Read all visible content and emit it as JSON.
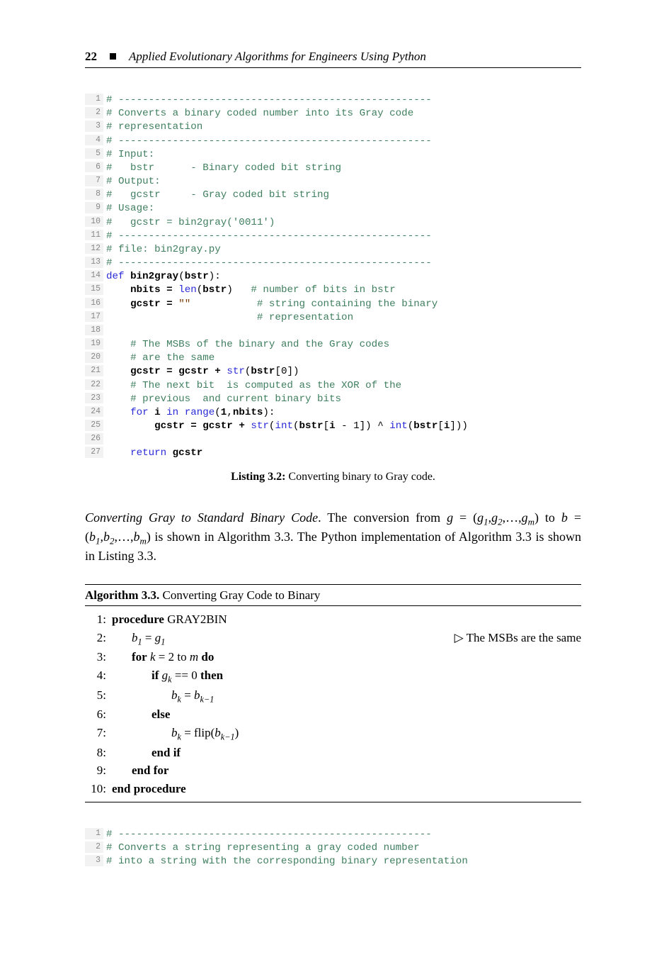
{
  "header": {
    "page_number": "22",
    "book_title": "Applied Evolutionary Algorithms for Engineers Using Python"
  },
  "code1": {
    "lines": [
      {
        "n": "1",
        "seg": [
          {
            "c": "com",
            "t": "# ----------------------------------------------------"
          }
        ]
      },
      {
        "n": "2",
        "seg": [
          {
            "c": "com",
            "t": "# Converts a binary coded number into its Gray code"
          }
        ]
      },
      {
        "n": "3",
        "seg": [
          {
            "c": "com",
            "t": "# representation"
          }
        ]
      },
      {
        "n": "4",
        "seg": [
          {
            "c": "com",
            "t": "# ----------------------------------------------------"
          }
        ]
      },
      {
        "n": "5",
        "seg": [
          {
            "c": "com",
            "t": "# Input:"
          }
        ]
      },
      {
        "n": "6",
        "seg": [
          {
            "c": "com",
            "t": "#   bstr      - Binary coded bit string"
          }
        ]
      },
      {
        "n": "7",
        "seg": [
          {
            "c": "com",
            "t": "# Output:"
          }
        ]
      },
      {
        "n": "8",
        "seg": [
          {
            "c": "com",
            "t": "#   gcstr     - Gray coded bit string"
          }
        ]
      },
      {
        "n": "9",
        "seg": [
          {
            "c": "com",
            "t": "# Usage:"
          }
        ]
      },
      {
        "n": "10",
        "seg": [
          {
            "c": "com",
            "t": "#   gcstr = bin2gray('0011')"
          }
        ]
      },
      {
        "n": "11",
        "seg": [
          {
            "c": "com",
            "t": "# ----------------------------------------------------"
          }
        ]
      },
      {
        "n": "12",
        "seg": [
          {
            "c": "com",
            "t": "# file: bin2gray.py"
          }
        ]
      },
      {
        "n": "13",
        "seg": [
          {
            "c": "com",
            "t": "# ----------------------------------------------------"
          }
        ]
      },
      {
        "n": "14",
        "seg": [
          {
            "c": "bi",
            "t": "def "
          },
          {
            "c": "nm",
            "t": "bin2gray"
          },
          {
            "c": "",
            "t": "("
          },
          {
            "c": "nm",
            "t": "bstr"
          },
          {
            "c": "",
            "t": "):"
          }
        ]
      },
      {
        "n": "15",
        "seg": [
          {
            "c": "",
            "t": "    "
          },
          {
            "c": "nm",
            "t": "nbits"
          },
          {
            "c": "",
            "t": " "
          },
          {
            "c": "nm",
            "t": "="
          },
          {
            "c": "",
            "t": " "
          },
          {
            "c": "bi",
            "t": "len"
          },
          {
            "c": "",
            "t": "("
          },
          {
            "c": "nm",
            "t": "bstr"
          },
          {
            "c": "",
            "t": ")   "
          },
          {
            "c": "com",
            "t": "# number of bits in bstr"
          }
        ]
      },
      {
        "n": "16",
        "seg": [
          {
            "c": "",
            "t": "    "
          },
          {
            "c": "nm",
            "t": "gcstr"
          },
          {
            "c": "",
            "t": " "
          },
          {
            "c": "nm",
            "t": "="
          },
          {
            "c": "",
            "t": " "
          },
          {
            "c": "str",
            "t": "\"\""
          },
          {
            "c": "",
            "t": "           "
          },
          {
            "c": "com",
            "t": "# string containing the binary"
          }
        ]
      },
      {
        "n": "17",
        "seg": [
          {
            "c": "",
            "t": "                         "
          },
          {
            "c": "com",
            "t": "# representation"
          }
        ]
      },
      {
        "n": "18",
        "seg": [
          {
            "c": "",
            "t": ""
          }
        ]
      },
      {
        "n": "19",
        "seg": [
          {
            "c": "",
            "t": "    "
          },
          {
            "c": "com",
            "t": "# The MSBs of the binary and the Gray codes"
          }
        ]
      },
      {
        "n": "20",
        "seg": [
          {
            "c": "",
            "t": "    "
          },
          {
            "c": "com",
            "t": "# are the same"
          }
        ]
      },
      {
        "n": "21",
        "seg": [
          {
            "c": "",
            "t": "    "
          },
          {
            "c": "nm",
            "t": "gcstr"
          },
          {
            "c": "",
            "t": " "
          },
          {
            "c": "nm",
            "t": "="
          },
          {
            "c": "",
            "t": " "
          },
          {
            "c": "nm",
            "t": "gcstr"
          },
          {
            "c": "",
            "t": " "
          },
          {
            "c": "nm",
            "t": "+"
          },
          {
            "c": "",
            "t": " "
          },
          {
            "c": "bi",
            "t": "str"
          },
          {
            "c": "",
            "t": "("
          },
          {
            "c": "nm",
            "t": "bstr"
          },
          {
            "c": "",
            "t": "[0])"
          }
        ]
      },
      {
        "n": "22",
        "seg": [
          {
            "c": "",
            "t": "    "
          },
          {
            "c": "com",
            "t": "# The next bit  is computed as the XOR of the"
          }
        ]
      },
      {
        "n": "23",
        "seg": [
          {
            "c": "",
            "t": "    "
          },
          {
            "c": "com",
            "t": "# previous  and current binary bits"
          }
        ]
      },
      {
        "n": "24",
        "seg": [
          {
            "c": "",
            "t": "    "
          },
          {
            "c": "bi",
            "t": "for"
          },
          {
            "c": "",
            "t": " "
          },
          {
            "c": "nm",
            "t": "i"
          },
          {
            "c": "",
            "t": " "
          },
          {
            "c": "bi",
            "t": "in"
          },
          {
            "c": "",
            "t": " "
          },
          {
            "c": "bi",
            "t": "range"
          },
          {
            "c": "",
            "t": "("
          },
          {
            "c": "nm",
            "t": "1"
          },
          {
            "c": "",
            "t": ","
          },
          {
            "c": "nm",
            "t": "nbits"
          },
          {
            "c": "",
            "t": "):"
          }
        ]
      },
      {
        "n": "25",
        "seg": [
          {
            "c": "",
            "t": "        "
          },
          {
            "c": "nm",
            "t": "gcstr"
          },
          {
            "c": "",
            "t": " "
          },
          {
            "c": "nm",
            "t": "="
          },
          {
            "c": "",
            "t": " "
          },
          {
            "c": "nm",
            "t": "gcstr"
          },
          {
            "c": "",
            "t": " "
          },
          {
            "c": "nm",
            "t": "+"
          },
          {
            "c": "",
            "t": " "
          },
          {
            "c": "bi",
            "t": "str"
          },
          {
            "c": "",
            "t": "("
          },
          {
            "c": "bi",
            "t": "int"
          },
          {
            "c": "",
            "t": "("
          },
          {
            "c": "nm",
            "t": "bstr"
          },
          {
            "c": "",
            "t": "["
          },
          {
            "c": "nm",
            "t": "i"
          },
          {
            "c": "",
            "t": " - 1]) ^ "
          },
          {
            "c": "bi",
            "t": "int"
          },
          {
            "c": "",
            "t": "("
          },
          {
            "c": "nm",
            "t": "bstr"
          },
          {
            "c": "",
            "t": "["
          },
          {
            "c": "nm",
            "t": "i"
          },
          {
            "c": "",
            "t": "]))"
          }
        ]
      },
      {
        "n": "26",
        "seg": [
          {
            "c": "",
            "t": ""
          }
        ]
      },
      {
        "n": "27",
        "seg": [
          {
            "c": "",
            "t": "    "
          },
          {
            "c": "bi",
            "t": "return"
          },
          {
            "c": "",
            "t": " "
          },
          {
            "c": "nm",
            "t": "gcstr"
          }
        ]
      }
    ]
  },
  "listing1": {
    "label": "Listing 3.2:",
    "caption": " Converting binary to Gray code."
  },
  "para1": {
    "run_in": "Converting Gray to Standard Binary Code",
    "period": ". ",
    "rest_a": "The conversion from ",
    "g_eq": "g = ",
    "g_tuple": "(g",
    "rest_b": ") to ",
    "b_eq": "b = (b",
    "rest_c": ") is shown in Algorithm 3.3. The Python implementation of Algorithm 3.3 is shown in Listing 3.3."
  },
  "algo": {
    "label": "Algorithm 3.3.",
    "title": " Converting Gray Code to Binary",
    "lines": [
      {
        "n": "1:",
        "indent": 0,
        "html": "<span class='kwd'>procedure</span> GRAY2BIN",
        "com": ""
      },
      {
        "n": "2:",
        "indent": 1,
        "html": "<span class='mi'>b</span><span class='sub'>1</span> = <span class='mi'>g</span><span class='sub'>1</span>",
        "com": "▷ The MSBs are the same"
      },
      {
        "n": "3:",
        "indent": 1,
        "html": "<span class='kwd'>for</span> <span class='mi'>k</span> = 2 to <span class='mi'>m</span> <span class='kwd'>do</span>",
        "com": ""
      },
      {
        "n": "4:",
        "indent": 2,
        "html": "<span class='kwd'>if</span> <span class='mi'>g<span class='sub'>k</span></span> == 0 <span class='kwd'>then</span>",
        "com": ""
      },
      {
        "n": "5:",
        "indent": 3,
        "html": "<span class='mi'>b<span class='sub'>k</span></span> = <span class='mi'>b<span class='sub'>k−1</span></span>",
        "com": ""
      },
      {
        "n": "6:",
        "indent": 2,
        "html": "<span class='kwd'>else</span>",
        "com": ""
      },
      {
        "n": "7:",
        "indent": 3,
        "html": "<span class='mi'>b<span class='sub'>k</span></span> = flip(<span class='mi'>b<span class='sub'>k−1</span></span>)",
        "com": ""
      },
      {
        "n": "8:",
        "indent": 2,
        "html": "<span class='kwd'>end if</span>",
        "com": ""
      },
      {
        "n": "9:",
        "indent": 1,
        "html": "<span class='kwd'>end for</span>",
        "com": ""
      },
      {
        "n": "10:",
        "indent": 0,
        "html": "<span class='kwd'>end procedure</span>",
        "com": ""
      }
    ]
  },
  "code2": {
    "lines": [
      {
        "n": "1",
        "seg": [
          {
            "c": "com",
            "t": "# ----------------------------------------------------"
          }
        ]
      },
      {
        "n": "2",
        "seg": [
          {
            "c": "com",
            "t": "# Converts a string representing a gray coded number"
          }
        ]
      },
      {
        "n": "3",
        "seg": [
          {
            "c": "com",
            "t": "# into a string with the corresponding binary representation"
          }
        ]
      }
    ]
  }
}
